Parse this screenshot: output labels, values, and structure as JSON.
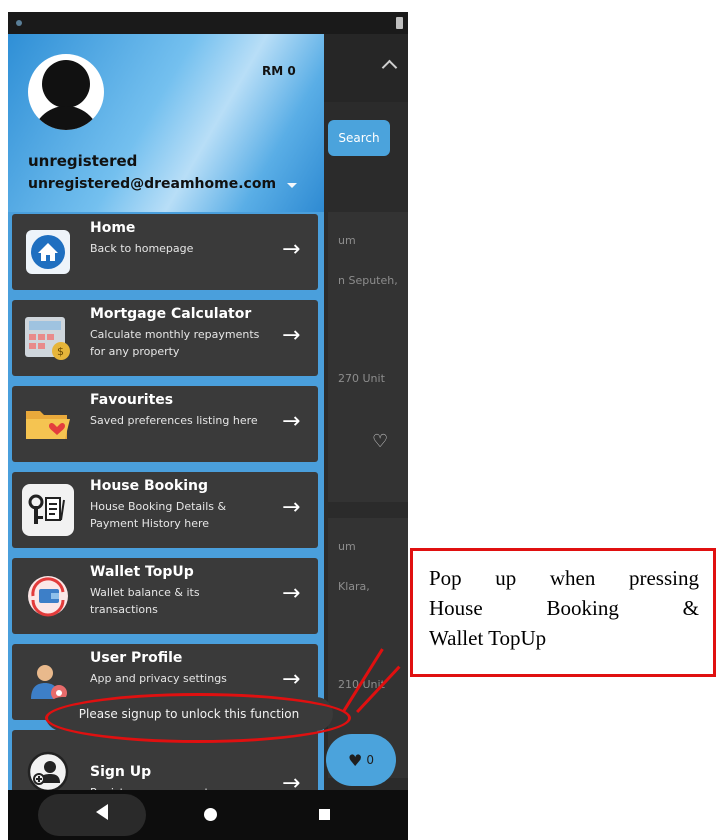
{
  "drawer": {
    "balance": "RM 0",
    "user_name": "unregistered",
    "user_email": "unregistered@dreamhome.com",
    "items": [
      {
        "title": "Home",
        "subtitle": "Back to homepage",
        "icon": "home-icon"
      },
      {
        "title": "Mortgage Calculator",
        "subtitle": "Calculate monthly repayments for any property",
        "icon": "calculator-icon"
      },
      {
        "title": "Favourites",
        "subtitle": "Saved preferences listing here",
        "icon": "folder-heart-icon"
      },
      {
        "title": "House Booking",
        "subtitle": "House Booking Details & Payment History here",
        "icon": "key-document-icon"
      },
      {
        "title": "Wallet TopUp",
        "subtitle": "Wallet balance & its transactions",
        "icon": "wallet-refresh-icon"
      },
      {
        "title": "User Profile",
        "subtitle": "App and privacy settings",
        "icon": "user-settings-icon"
      },
      {
        "title": "Sign Up",
        "subtitle": "Register new account",
        "icon": "add-user-icon"
      }
    ]
  },
  "background": {
    "search_label": "Search",
    "card1": {
      "line1": "um",
      "line2": "n Seputeh,",
      "line3": "270 Unit"
    },
    "card2": {
      "line1": "um",
      "line2": "Klara,",
      "line3": "210 Unit"
    },
    "fab_count": "0"
  },
  "toast": "Please signup to unlock this function",
  "annotation": {
    "line1": [
      "Pop",
      "up",
      "when",
      "pressing"
    ],
    "line2": [
      "House",
      "Booking",
      "&"
    ],
    "line3": "Wallet TopUp"
  },
  "colors": {
    "accent": "#4ba3dc",
    "annotation": "#e01010",
    "menu_bg": "#3a3a3a"
  }
}
